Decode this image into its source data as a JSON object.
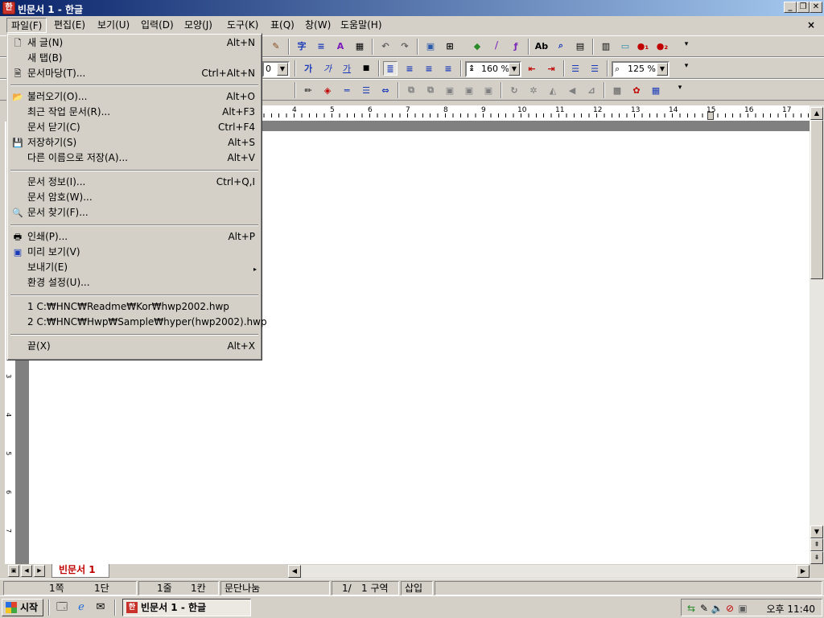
{
  "window": {
    "title": "빈문서 1 - 한글"
  },
  "menubar": [
    "파일(F)",
    "편집(E)",
    "보기(U)",
    "입력(D)",
    "모양(J)",
    "도구(K)",
    "표(Q)",
    "창(W)",
    "도움말(H)"
  ],
  "toolbar2": {
    "font_size_value": "0",
    "char_buttons": [
      "가",
      "가",
      "가"
    ],
    "line_spacing": "160 %",
    "zoom": "125 %"
  },
  "ruler": {
    "numbers": [
      "4",
      "5",
      "6",
      "7",
      "8",
      "9",
      "10",
      "11",
      "12",
      "13",
      "14",
      "15",
      "16",
      "17"
    ]
  },
  "vruler": {
    "numbers": [
      "3",
      "4",
      "5",
      "6",
      "7"
    ]
  },
  "file_menu": {
    "items": [
      {
        "label": "새 글(N)",
        "shortcut": "Alt+N",
        "icon": "new-document-icon"
      },
      {
        "label": "새 탭(B)",
        "shortcut": "",
        "icon": ""
      },
      {
        "label": "문서마당(T)...",
        "shortcut": "Ctrl+Alt+N",
        "icon": "template-icon"
      },
      {
        "label": "불러오기(O)...",
        "shortcut": "Alt+O",
        "icon": "open-folder-icon"
      },
      {
        "label": "최근 작업 문서(R)...",
        "shortcut": "Alt+F3",
        "icon": ""
      },
      {
        "label": "문서 닫기(C)",
        "shortcut": "Ctrl+F4",
        "icon": ""
      },
      {
        "label": "저장하기(S)",
        "shortcut": "Alt+S",
        "icon": "save-disk-icon"
      },
      {
        "label": "다른 이름으로 저장(A)...",
        "shortcut": "Alt+V",
        "icon": ""
      },
      {
        "label": "문서 정보(I)...",
        "shortcut": "Ctrl+Q,I",
        "icon": ""
      },
      {
        "label": "문서 암호(W)...",
        "shortcut": "",
        "icon": ""
      },
      {
        "label": "문서 찾기(F)...",
        "shortcut": "",
        "icon": "find-document-icon"
      },
      {
        "label": "인쇄(P)...",
        "shortcut": "Alt+P",
        "icon": "printer-icon"
      },
      {
        "label": "미리 보기(V)",
        "shortcut": "",
        "icon": "preview-icon"
      },
      {
        "label": "보내기(E)",
        "shortcut": "",
        "icon": ""
      },
      {
        "label": "환경 설정(U)...",
        "shortcut": "",
        "icon": ""
      },
      {
        "label": "1 C:₩HNC₩Readme₩Kor₩hwp2002.hwp",
        "shortcut": "",
        "icon": ""
      },
      {
        "label": "2 C:₩HNC₩Hwp₩Sample₩hyper(hwp2002).hwp",
        "shortcut": "",
        "icon": ""
      },
      {
        "label": "끝(X)",
        "shortcut": "Alt+X",
        "icon": ""
      }
    ]
  },
  "tabs": {
    "document_tab": "빈문서 1"
  },
  "statusbar": {
    "page": "1쪽",
    "section_page": "1단",
    "line": "1줄",
    "column": "1칸",
    "break": "문단나눔",
    "page_of": "1/",
    "section": "1 구역",
    "mode": "삽입"
  },
  "taskbar": {
    "start": "시작",
    "task_item": "빈문서 1 - 한글",
    "clock": "오후 11:40"
  },
  "colors": {
    "title_gradient_start": "#0a246a",
    "title_gradient_end": "#a6caf0",
    "face": "#d4d0c8",
    "doc_tab_text": "#c00000"
  }
}
